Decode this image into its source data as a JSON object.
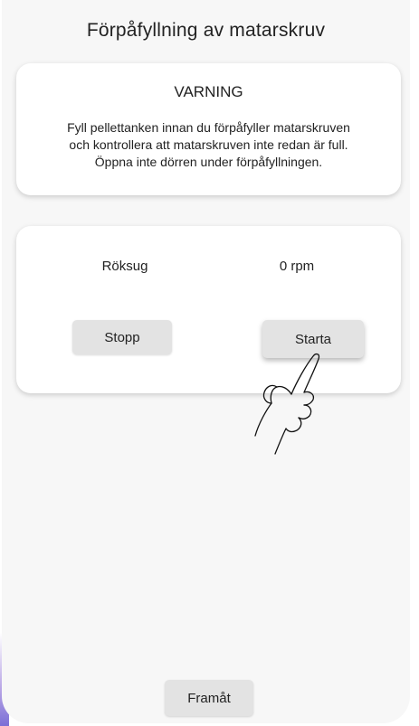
{
  "header": {
    "title": "Förpåfyllning av matarskruv"
  },
  "warning": {
    "heading": "VARNING",
    "lines": [
      "Fyll pellettanken innan du förpåfyller matarskruven",
      "och kontrollera att matarskruven inte redan är full.",
      "Öppna inte dörren under förpåfyllningen."
    ]
  },
  "control": {
    "fan_label": "Röksug",
    "fan_value": "0 rpm",
    "stop_label": "Stopp",
    "start_label": "Starta"
  },
  "footer": {
    "forward_label": "Framåt"
  },
  "colors": {
    "background": "#f7f7f7",
    "card": "#ffffff",
    "button": "#e3e3e3",
    "accent": "#7b6fd6"
  },
  "icons": {
    "pointer": "tap-hand-icon"
  }
}
